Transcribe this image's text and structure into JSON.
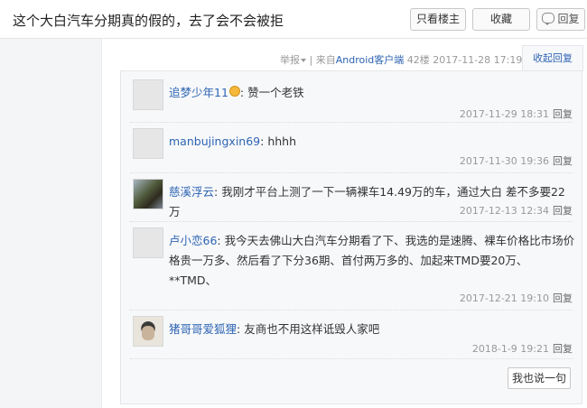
{
  "thread": {
    "title": "这个大白汽车分期真的假的，去了会不会被拒"
  },
  "toolbar": {
    "only_op": "只看楼主",
    "favorite": "收藏",
    "reply": "回复"
  },
  "post_meta": {
    "report": "举报",
    "separator": "|",
    "source": "来自",
    "client": "Android客户端",
    "floor": "42楼",
    "time": "2017-11-28 17:19",
    "collapse_reply": "收起回复"
  },
  "replies": [
    {
      "user": "追梦少年11",
      "has_emoji": true,
      "content": "赞一个老铁",
      "time": "2017-11-29 18:31",
      "reply_label": "回复"
    },
    {
      "user": "manbujingxin69",
      "content": "hhhh",
      "time": "2017-11-30 19:36",
      "reply_label": "回复"
    },
    {
      "user": "慈溪浮云",
      "content": "我刚才平台上测了一下一辆裸车14.49万的车，通过大白 差不多要22万",
      "time": "2017-12-13 12:34",
      "reply_label": "回复"
    },
    {
      "user": "卢小恋66",
      "content": "我今天去佛山大白汽车分期看了下、我选的是速腾、裸车价格比市场价格贵一万多、然后看了下分36期、首付两万多的、加起来TMD要20万、**TMD、",
      "time": "2017-12-21 19:10",
      "reply_label": "回复"
    },
    {
      "user": "猪哥哥爱狐狸",
      "content": "友商也不用这样诋毁人家吧",
      "time": "2018-1-9 19:21",
      "reply_label": "回复"
    }
  ],
  "say_button": "我也说一句",
  "colors": {
    "link": "#2d64b3",
    "meta": "#999999",
    "panel_bg": "#f7f8fa"
  }
}
